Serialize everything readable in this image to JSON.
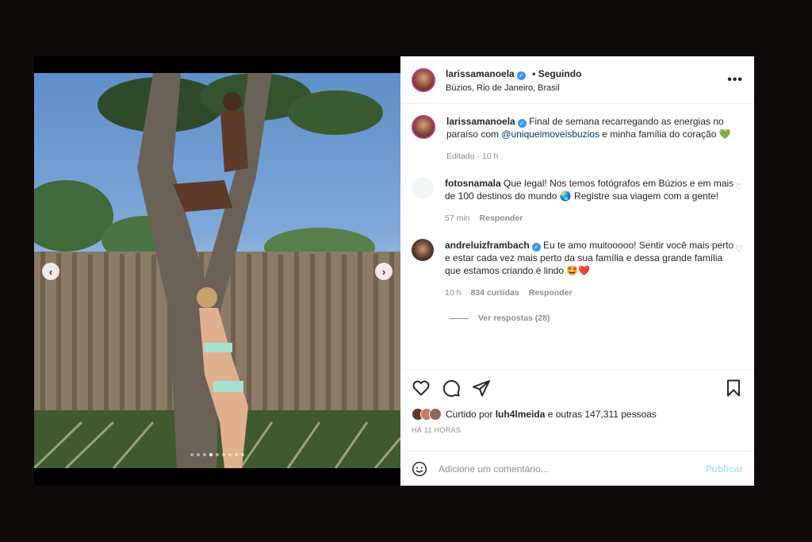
{
  "post": {
    "username": "larissamanoela",
    "verified_symbol": "✓",
    "follow_status": "• Seguindo",
    "location": "Búzios, Rio de Janeiro, Brasil",
    "more_icon": "more-options-icon"
  },
  "caption": {
    "username": "larissamanoela",
    "text_before": "Final de semana recarregando as energias no paraíso com ",
    "mention": "@uniqueimoveisbuzios",
    "text_after": " e minha família do coração ",
    "emoji": "💚",
    "meta": "Editado · 10 h"
  },
  "comments": [
    {
      "username": "fotosnamala",
      "text": "Que legal! Nos temos fotógrafos em Búzios e em mais de 100 destinos do mundo 🌏 Registre sua viagem com a gente!",
      "time": "57 min",
      "reply": "Responder"
    },
    {
      "username": "andreluizframbach",
      "text": "Eu te amo muitooooo! Sentir você mais perto e estar cada vez mais perto da sua família e dessa grande família que estamos criando é lindo 🤩❤️",
      "time": "10 h",
      "likes": "834 curtidas",
      "reply": "Responder",
      "view_replies": "Ver respostas (28)"
    }
  ],
  "likes": {
    "prefix": "Curtido por ",
    "user": "luh4lmeida",
    "suffix": " e outras 147,311 pessoas"
  },
  "timestamp": "HÁ 11 HORAS",
  "add_comment": {
    "placeholder": "Adicione um comentário...",
    "publish": "Publicar"
  },
  "carousel": {
    "prev": "‹",
    "next": "›",
    "dot_count": 9,
    "active_index": 3
  },
  "colors": {
    "accent_link": "#00376b",
    "verified": "#3897f0",
    "publish_disabled": "#b2dffc"
  }
}
